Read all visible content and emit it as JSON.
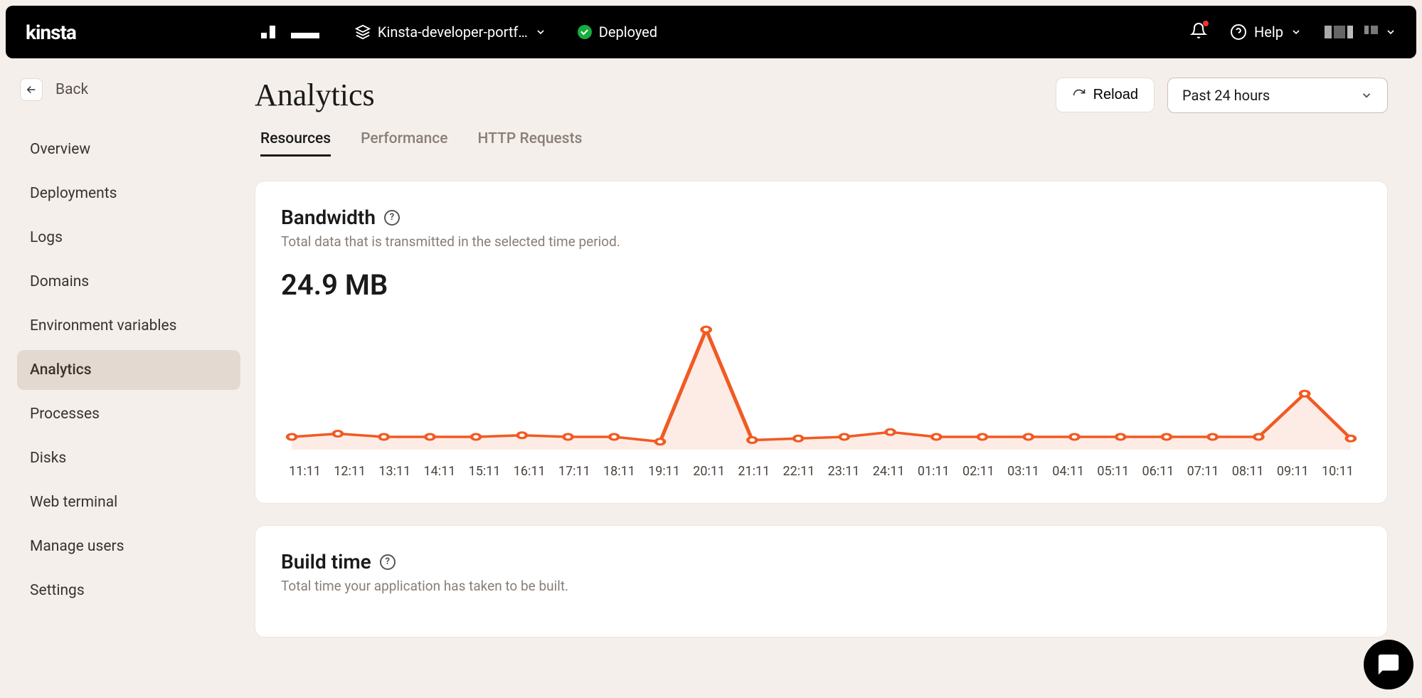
{
  "topbar": {
    "logo": "kinsta",
    "project_name": "Kinsta-developer-portf…",
    "status_label": "Deployed",
    "help_label": "Help"
  },
  "sidebar": {
    "back_label": "Back",
    "items": [
      {
        "label": "Overview"
      },
      {
        "label": "Deployments"
      },
      {
        "label": "Logs"
      },
      {
        "label": "Domains"
      },
      {
        "label": "Environment variables"
      },
      {
        "label": "Analytics"
      },
      {
        "label": "Processes"
      },
      {
        "label": "Disks"
      },
      {
        "label": "Web terminal"
      },
      {
        "label": "Manage users"
      },
      {
        "label": "Settings"
      }
    ],
    "active_index": 5
  },
  "page": {
    "title": "Analytics",
    "reload_label": "Reload",
    "time_range": "Past 24 hours",
    "tabs": [
      {
        "label": "Resources"
      },
      {
        "label": "Performance"
      },
      {
        "label": "HTTP Requests"
      }
    ],
    "active_tab": 0
  },
  "cards": {
    "bandwidth": {
      "title": "Bandwidth",
      "subtitle": "Total data that is transmitted in the selected time period.",
      "value": "24.9 MB"
    },
    "build_time": {
      "title": "Build time",
      "subtitle": "Total time your application has taken to be built."
    }
  },
  "chart_data": {
    "type": "line",
    "title": "Bandwidth",
    "xlabel": "",
    "ylabel": "",
    "categories": [
      "11:11",
      "12:11",
      "13:11",
      "14:11",
      "15:11",
      "16:11",
      "17:11",
      "18:11",
      "19:11",
      "20:11",
      "21:11",
      "22:11",
      "23:11",
      "24:11",
      "01:11",
      "02:11",
      "03:11",
      "04:11",
      "05:11",
      "06:11",
      "07:11",
      "08:11",
      "09:11",
      "10:11"
    ],
    "values": [
      0.8,
      1.0,
      0.8,
      0.8,
      0.8,
      0.9,
      0.8,
      0.8,
      0.5,
      7.5,
      0.6,
      0.7,
      0.8,
      1.1,
      0.8,
      0.8,
      0.8,
      0.8,
      0.8,
      0.8,
      0.8,
      0.8,
      3.5,
      0.7
    ],
    "ylim": [
      0,
      8
    ],
    "color": "#f15a22"
  }
}
